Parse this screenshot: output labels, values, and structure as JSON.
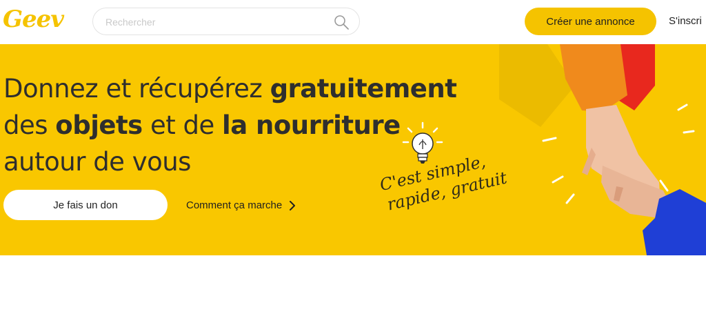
{
  "header": {
    "logo_text": "Geev",
    "search_placeholder": "Rechercher",
    "create_button": "Créer une annonce",
    "signup_link": "S'inscri"
  },
  "hero": {
    "headline": {
      "line1_a": "Donnez et récupérez ",
      "line1_b": "gratuitement",
      "line2_a": "des ",
      "line2_b": "objets",
      "line2_c": " et de ",
      "line2_d": "la nourriture",
      "line3": "autour de vous"
    },
    "donate_button": "Je fais un don",
    "how_link": "Comment ça marche",
    "tagline_line1": "C'est simple,",
    "tagline_line2": "rapide, gratuit"
  },
  "colors": {
    "brand_yellow": "#f5c300",
    "hero_background": "#f9c700"
  },
  "icons": [
    "search-icon",
    "chevron-right-icon",
    "lightbulb-icon"
  ]
}
